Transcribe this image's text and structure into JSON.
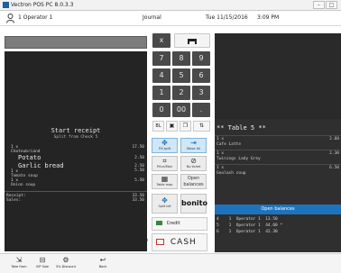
{
  "window": {
    "title": "Vectron POS PC 8.0.3.3"
  },
  "header": {
    "operator": "1 Operator 1",
    "view": "Journal",
    "date": "Tue 11/15/2016",
    "time": "3:09 PM"
  },
  "receipt": {
    "title": "Start receipt",
    "subtitle": "Split from Check 5",
    "lines": [
      {
        "label": "1 x",
        "amount": "17.50"
      },
      {
        "label": "Chateubriand",
        "amount": ""
      },
      {
        "label": "Potato",
        "amount": "2.50",
        "big": true
      },
      {
        "label": "Garlic bread",
        "amount": "2.50",
        "big": true
      },
      {
        "label": "1 x",
        "amount": "5.50"
      },
      {
        "label": "Tomato soup",
        "amount": ""
      },
      {
        "label": "1 x",
        "amount": "5.50"
      },
      {
        "label": "Onion soup",
        "amount": ""
      }
    ],
    "totals": [
      {
        "label": "Receipt:",
        "amount": "33.50"
      },
      {
        "label": "Sales:",
        "amount": "33.50"
      }
    ]
  },
  "keypad": {
    "keys": [
      "x",
      "",
      "7",
      "8",
      "9",
      "4",
      "5",
      "6",
      "1",
      "2",
      "3",
      "0",
      "00",
      "."
    ]
  },
  "functions": {
    "f1": "Fill split",
    "f2": "Move All",
    "f3": "Price/Man",
    "f4": "No ticket",
    "f5": "Table map",
    "f6": "Open balances",
    "f7": "Split bill",
    "f8": "bonito",
    "credit": "Credit",
    "cash": "CASH",
    "cash_amount": "0"
  },
  "table_panel": {
    "title": "** Table 5 **",
    "items": [
      {
        "qty": "1 x",
        "name": "Cafe Latte",
        "amount": "2.60"
      },
      {
        "qty": "1 x",
        "name": "Twinings Lady Grey",
        "amount": "2.30"
      },
      {
        "qty": "1 x",
        "name": "Goulash soup",
        "amount": "6.50"
      }
    ]
  },
  "open_balances": {
    "header": "Open balances",
    "rows": [
      {
        "no": "4",
        "op": "1  Operator 1",
        "amount": "13.50"
      },
      {
        "no": "5",
        "op": "1  Operator 1",
        "amount": "44.60 *"
      },
      {
        "no": "6",
        "op": "1  Operator 1",
        "amount": "42.30"
      }
    ]
  },
  "bottombar": {
    "items": [
      {
        "label": "Take from",
        "icon": "exit-icon"
      },
      {
        "label": "VIP Sale",
        "icon": "stamp-icon"
      },
      {
        "label": "5% Discount",
        "icon": "gear-icon"
      },
      {
        "label": "Back",
        "icon": "back-icon"
      }
    ]
  }
}
